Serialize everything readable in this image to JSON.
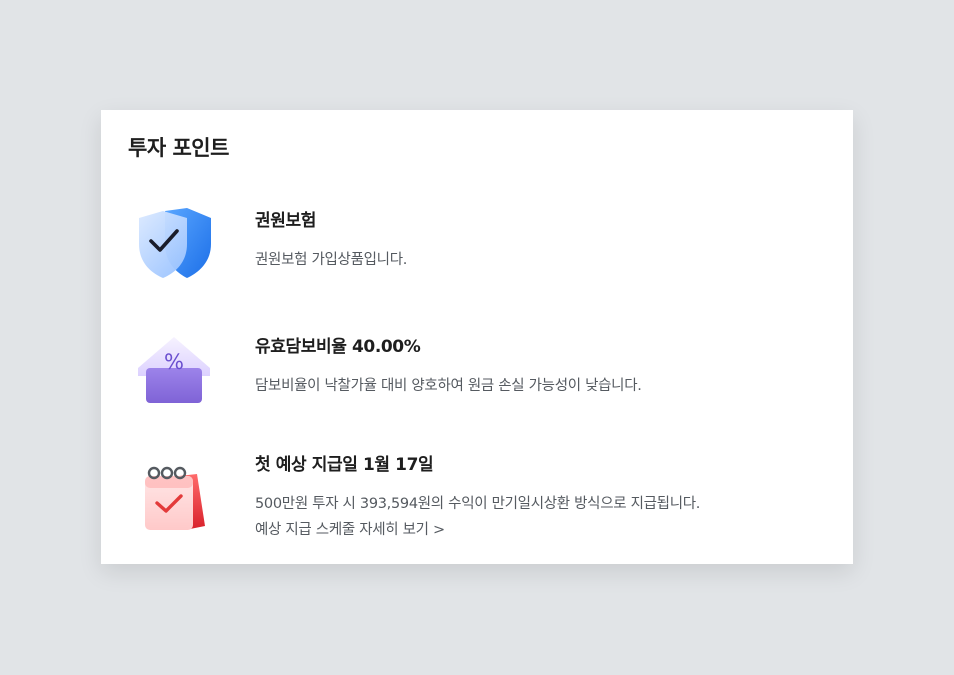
{
  "card": {
    "title": "투자 포인트"
  },
  "points": [
    {
      "icon": "shield-check-icon",
      "heading": "권원보험",
      "description": "권원보험 가입상품입니다."
    },
    {
      "icon": "house-percent-icon",
      "heading": "유효담보비율 40.00%",
      "description": "담보비율이 낙찰가율 대비 양호하여 원금 손실 가능성이 낮습니다."
    },
    {
      "icon": "calendar-check-icon",
      "heading": "첫 예상 지급일 1월 17일",
      "description": "500만원 투자 시 393,594원의 수익이 만기일시상환 방식으로 지급됩니다.",
      "link": "예상 지급 스케줄 자세히 보기 >"
    }
  ],
  "colors": {
    "background": "#e1e4e7",
    "card": "#ffffff",
    "heading": "#1e1e1e",
    "body_text": "#555a60",
    "shield_blue": "#2f86f2",
    "house_purple": "#8b6fd9",
    "calendar_red": "#e33a3a"
  }
}
